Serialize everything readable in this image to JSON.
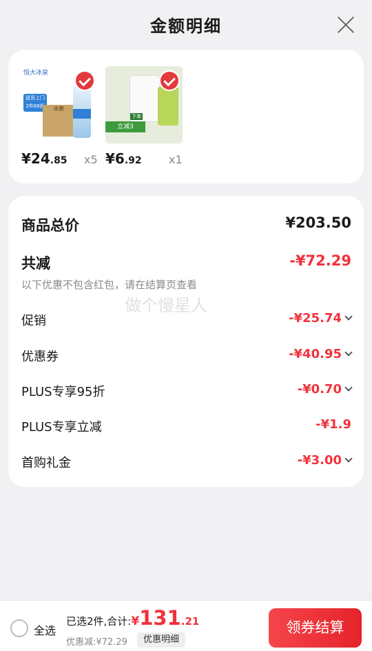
{
  "header": {
    "title": "金额明细"
  },
  "products": [
    {
      "price_int": "¥24",
      "price_dec": ".85",
      "qty": "x5"
    },
    {
      "price_int": "¥6",
      "price_dec": ".92",
      "qty": "x1"
    }
  ],
  "product_images": {
    "p1": {
      "brand": "恒大冰泉",
      "badge_line1": "送货上门",
      "badge_line2": "2件88折",
      "box_text": "冰泉"
    },
    "p2": {
      "tag": "下单",
      "promo": "立减3"
    }
  },
  "summary": {
    "total_label": "商品总价",
    "total_value": "¥203.50",
    "discount_label": "共减",
    "discount_value": "-¥72.29",
    "note": "以下优惠不包含红包，请在结算页查看",
    "items": [
      {
        "label": "促销",
        "value": "-¥25.74",
        "expandable": true
      },
      {
        "label": "优惠券",
        "value": "-¥40.95",
        "expandable": true
      },
      {
        "label": "PLUS专享95折",
        "value": "-¥0.70",
        "expandable": true
      },
      {
        "label": "PLUS专享立减",
        "value": "-¥1.9",
        "expandable": false
      },
      {
        "label": "首购礼金",
        "value": "-¥3.00",
        "expandable": true
      }
    ]
  },
  "watermark": "做个慢星人",
  "bottom": {
    "select_all": "全选",
    "selected_text": "已选2件,合计:",
    "total_currency": "¥",
    "total_int": "131",
    "total_dec": ".21",
    "discount_text": "优惠减:¥72.29",
    "detail_tag": "优惠明细",
    "checkout": "领券结算"
  },
  "colors": {
    "accent": "#f0323c",
    "check": "#e4393c",
    "button": "#e6232b"
  }
}
